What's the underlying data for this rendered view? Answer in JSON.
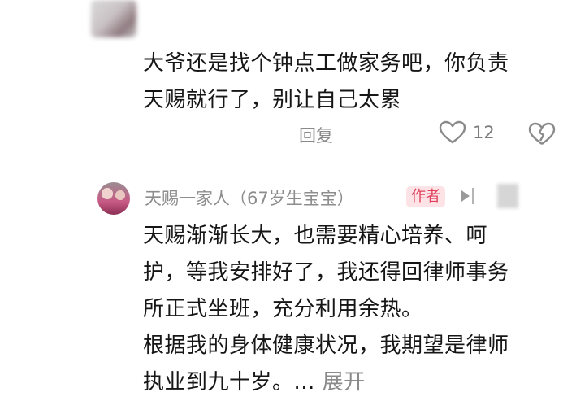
{
  "comment1": {
    "text": "大爷还是找个钟点工做家务吧，你负责\n天赐就行了，别让自己太累",
    "reply_label": "回复",
    "like_count": "12"
  },
  "comment2": {
    "username": "天赐一家人（67岁生宝宝）",
    "badge": "作者",
    "text": "天赐渐渐长大，也需要精心培养、呵\n护，等我安排好了，我还得回律师事务\n所正式坐班，充分利用余热。\n根据我的身体健康状况，我期望是律师\n执业到九十岁。",
    "ellipsis": "...",
    "expand_label": "展开"
  },
  "colors": {
    "badge_bg": "#fde2e6",
    "badge_text": "#e0405b",
    "meta_gray": "#8a8a8a"
  }
}
